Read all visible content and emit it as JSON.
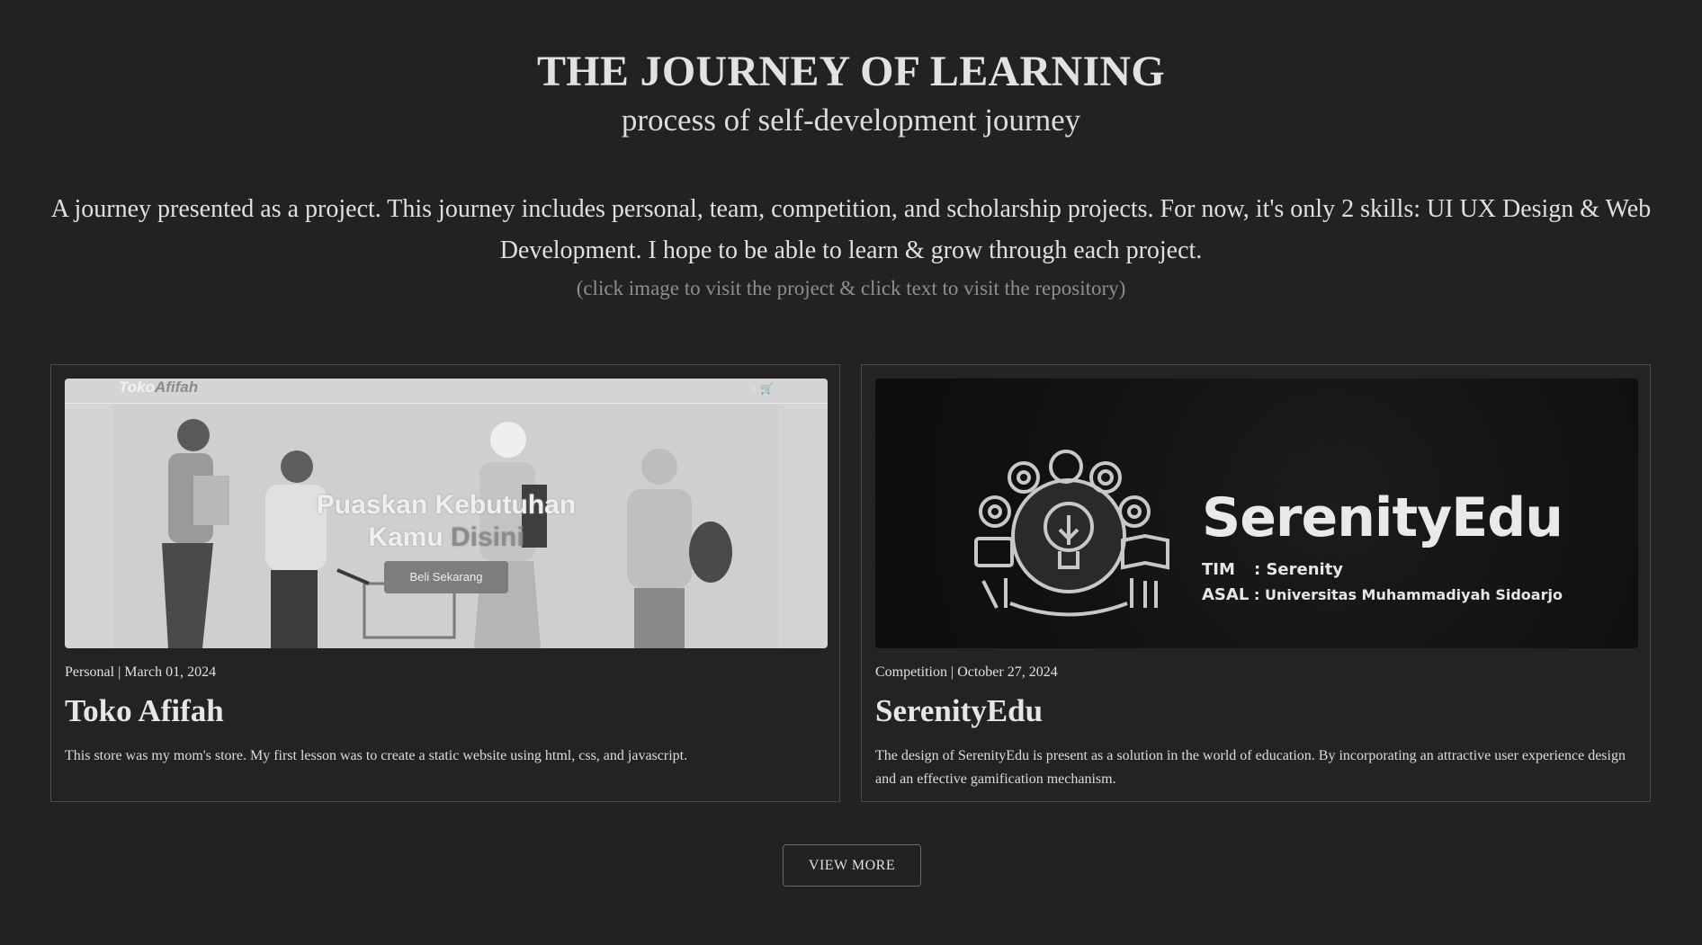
{
  "header": {
    "title": "THE JOURNEY OF LEARNING",
    "subtitle": "process of self-development journey",
    "intro": "A journey presented as a project. This journey includes personal, team, competition, and scholarship projects. For now, it's only 2 skills: UI UX Design & Web Development. I hope to be able to learn & grow through each project.",
    "hint": "(click image to visit the project & click text to visit the repository)"
  },
  "projects": [
    {
      "meta": "Personal | March 01, 2024",
      "title": "Toko Afifah",
      "description": "This store was my mom's store. My first lesson was to create a static website using html, css, and javascript.",
      "thumb": {
        "logo_a": "Toko",
        "logo_b": "Afifah",
        "headline_1": "Puaskan Kebutuhan",
        "headline_2a": "Kamu ",
        "headline_2b": "Disini",
        "button": "Beli Sekarang",
        "icons": "⌕ 🛒"
      }
    },
    {
      "meta": "Competition | October 27, 2024",
      "title": "SerenityEdu",
      "description": "The design of SerenityEdu is present as a solution in the world of education. By incorporating an attractive user experience design and an effective gamification mechanism.",
      "thumb": {
        "brand": "SerenityEdu",
        "tim_key": "TIM",
        "tim_val": ":  Serenity",
        "asal_key": "ASAL",
        "asal_val": ":  Universitas Muhammadiyah Sidoarjo"
      }
    }
  ],
  "view_more": "VIEW MORE",
  "colors": {
    "background": "#222222",
    "card_border": "#4a4a4a",
    "hint": "#8e8e8e"
  }
}
